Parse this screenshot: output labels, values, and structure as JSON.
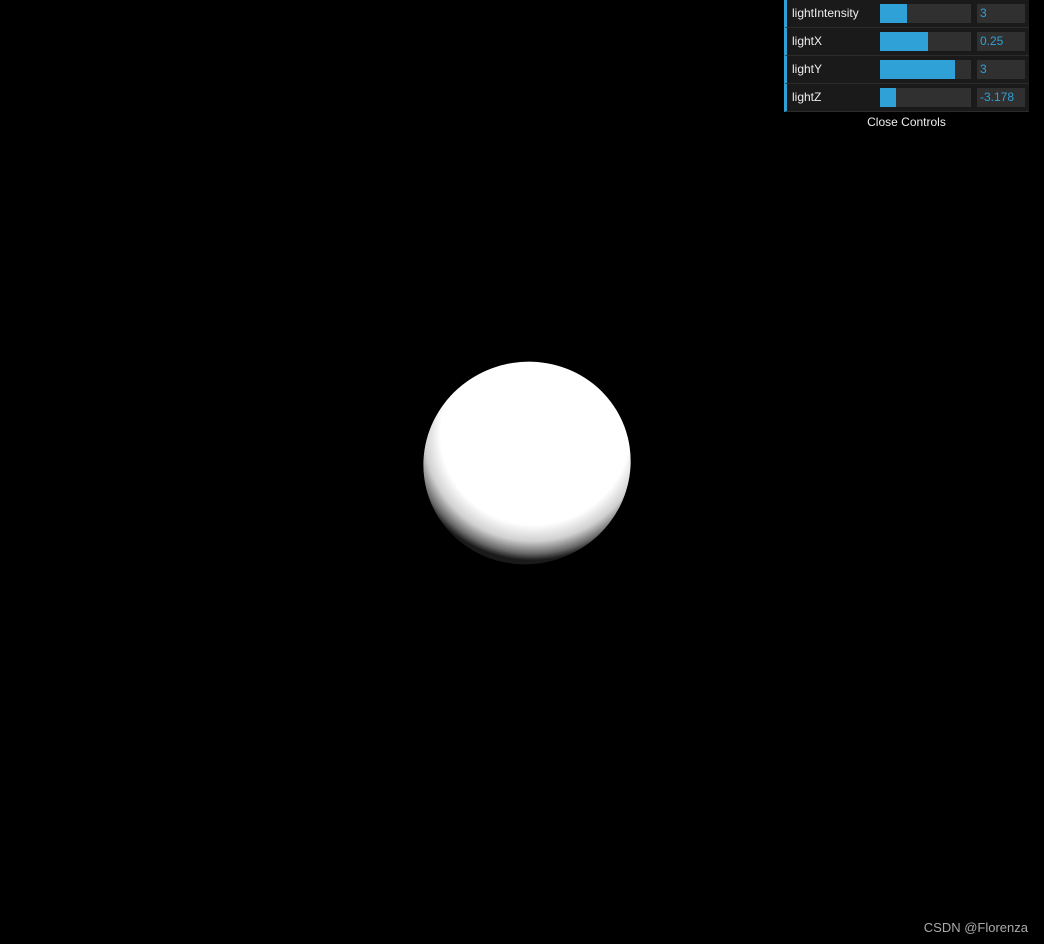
{
  "gui": {
    "controls": [
      {
        "label": "lightIntensity",
        "value": "3",
        "fill_fraction": 0.3
      },
      {
        "label": "lightX",
        "value": "0.25",
        "fill_fraction": 0.53
      },
      {
        "label": "lightY",
        "value": "3",
        "fill_fraction": 0.82
      },
      {
        "label": "lightZ",
        "value": "-3.178",
        "fill_fraction": 0.18
      }
    ],
    "close_label": "Close Controls"
  },
  "watermark": "CSDN @Florenza",
  "colors": {
    "background": "#000000",
    "accent": "#2fa1d6",
    "panel": "#1a1a1a",
    "sphere": "#ffffff"
  }
}
